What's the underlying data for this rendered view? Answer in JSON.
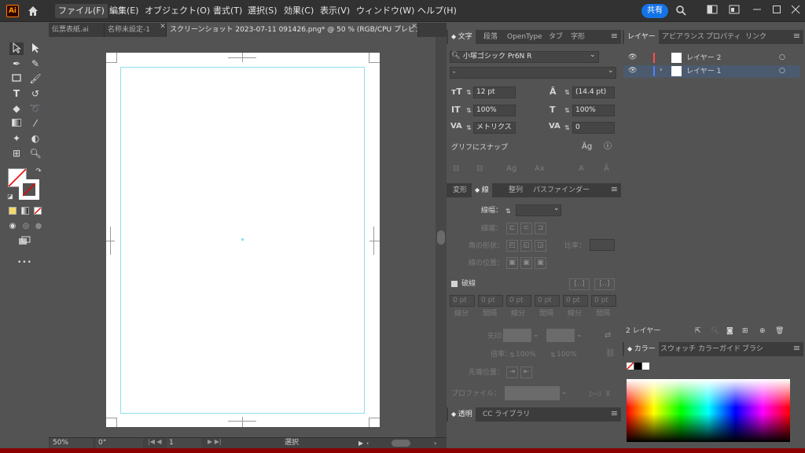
{
  "app": {
    "logo_text": "Ai"
  },
  "menubar": {
    "items": [
      "ファイル(F)",
      "編集(E)",
      "オブジェクト(O)",
      "書式(T)",
      "選択(S)",
      "効果(C)",
      "表示(V)",
      "ウィンドウ(W)",
      "ヘルプ(H)"
    ],
    "share_label": "共有"
  },
  "tabs": [
    {
      "label": "伝票表紙.ai",
      "active": false
    },
    {
      "label": "名称未設定-1",
      "active": false
    },
    {
      "label": "スクリーンショット 2023-07-11 091426.png* @ 50 % (RGB/CPU プレビュー)",
      "active": true
    }
  ],
  "toolbar": {
    "more_label": "•••"
  },
  "status": {
    "zoom": "50%",
    "rotation": "0°",
    "artboard": "1",
    "mode": "選択"
  },
  "character_panel": {
    "tabs": [
      "文字",
      "段落",
      "OpenType",
      "タブ",
      "字形"
    ],
    "font_family": "小塚ゴシック Pr6N R",
    "font_style": "-",
    "font_size": "12 pt",
    "leading": "(14.4 pt)",
    "vertical_scale": "100%",
    "horizontal_scale": "100%",
    "kerning": "メトリクス",
    "tracking": "0",
    "snap_label": "グリフにスナップ"
  },
  "stroke_panel": {
    "tabs": [
      "変形",
      "線",
      "整列",
      "パスファインダー"
    ],
    "weight_label": "線幅：",
    "weight_value": "",
    "cap_label": "線端：",
    "corner_label": "角の形状：",
    "limit_label": "比率：",
    "align_label": "線の位置：",
    "dashed_label": "破線",
    "dash_cells": [
      {
        "value": "0 pt",
        "label": "線分"
      },
      {
        "value": "0 pt",
        "label": "間隔"
      },
      {
        "value": "0 pt",
        "label": "線分"
      },
      {
        "value": "0 pt",
        "label": "間隔"
      },
      {
        "value": "0 pt",
        "label": "線分"
      },
      {
        "value": "0 pt",
        "label": "間隔"
      }
    ],
    "arrow_label": "矢印：",
    "scale_label": "倍率：",
    "scale_a": "100%",
    "scale_b": "100%",
    "tip_label": "先端位置：",
    "profile_label": "プロファイル："
  },
  "transparency_panel": {
    "tabs": [
      "透明",
      "CC ライブラリ"
    ]
  },
  "layers_panel": {
    "tabs": [
      "レイヤー",
      "アピアランス",
      "プロパティ",
      "リンク"
    ],
    "layers": [
      {
        "name": "レイヤー 2",
        "color": "#ff4d4d",
        "selected": false
      },
      {
        "name": "レイヤー 1",
        "color": "#4f80ff",
        "selected": true
      }
    ],
    "count_label": "2 レイヤー"
  },
  "color_panel": {
    "tabs": [
      "カラー",
      "スウォッチ",
      "カラーガイド",
      "ブラシ"
    ]
  },
  "colors": {
    "accent": "#1473e6",
    "bleed_guide": "#8fe0f0",
    "layer_selected": "#4b5a6e"
  }
}
